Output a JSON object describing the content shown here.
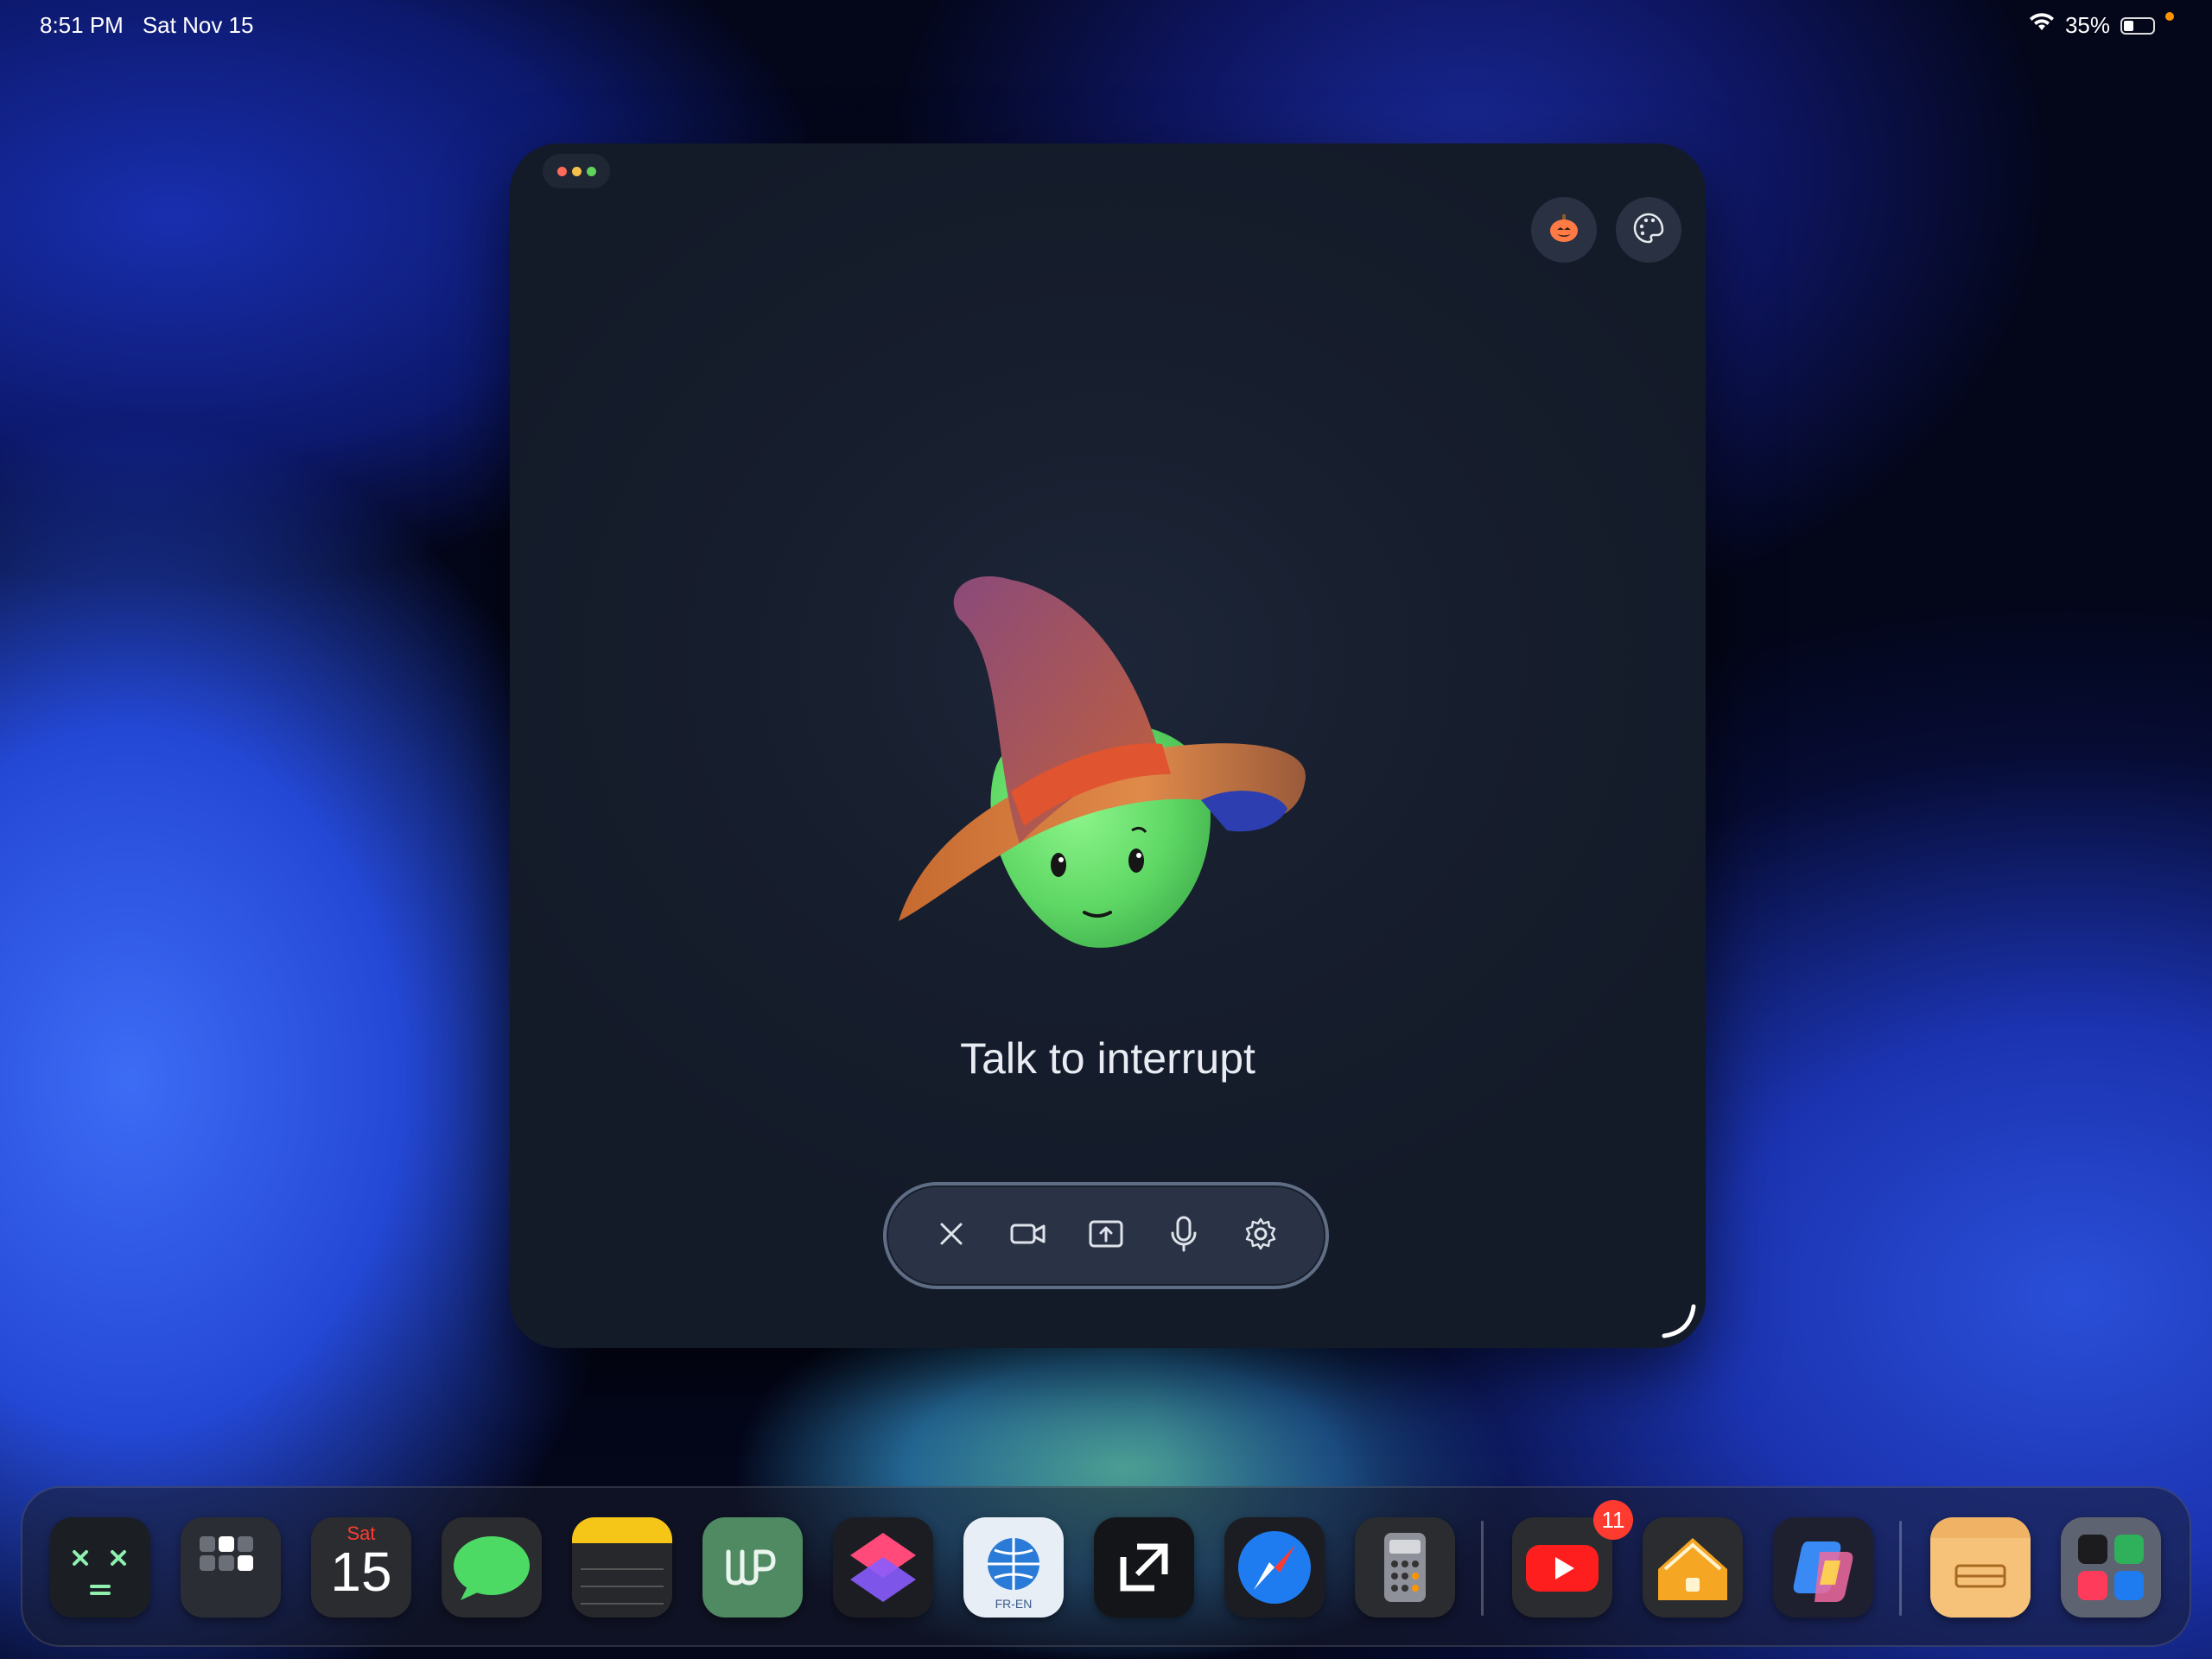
{
  "status_bar": {
    "time": "8:51 PM",
    "date": "Sat Nov 15",
    "battery_percent": "35%",
    "battery_level": 0.35
  },
  "window": {
    "prompt_text": "Talk to interrupt",
    "top_buttons": [
      {
        "icon": "pumpkin-icon"
      },
      {
        "icon": "palette-icon"
      }
    ],
    "toolbar": [
      {
        "icon": "close-icon"
      },
      {
        "icon": "video-camera-icon"
      },
      {
        "icon": "share-screen-icon"
      },
      {
        "icon": "microphone-icon"
      },
      {
        "icon": "gear-icon"
      }
    ]
  },
  "dock": {
    "apps": [
      {
        "name": "calculator-widget",
        "icon": "x-x-equals-icon"
      },
      {
        "name": "app-library",
        "icon": "grid-icon"
      },
      {
        "name": "calendar",
        "day_label": "Sat",
        "date_number": "15"
      },
      {
        "name": "messages",
        "icon": "chat-bubble-icon"
      },
      {
        "name": "notes",
        "icon": "notes-icon"
      },
      {
        "name": "word-app",
        "icon": "wp-icon"
      },
      {
        "name": "shortcuts",
        "icon": "shortcuts-icon"
      },
      {
        "name": "translate",
        "icon": "globe-icon",
        "label": "FR-EN"
      },
      {
        "name": "screen-capture",
        "icon": "crop-icon"
      },
      {
        "name": "safari",
        "icon": "compass-icon"
      },
      {
        "name": "calculator",
        "icon": "calculator-icon"
      },
      {
        "name": "youtube",
        "icon": "play-icon",
        "badge": "11"
      },
      {
        "name": "home",
        "icon": "house-icon"
      },
      {
        "name": "copilot",
        "icon": "copilot-icon"
      },
      {
        "name": "files",
        "icon": "folder-icon"
      },
      {
        "name": "apps-folder",
        "icon": "folder-grid-icon"
      }
    ]
  },
  "colors": {
    "window_bg": "#161d2c",
    "accent_green": "#6ddc6a",
    "badge_red": "#ff3b30"
  }
}
